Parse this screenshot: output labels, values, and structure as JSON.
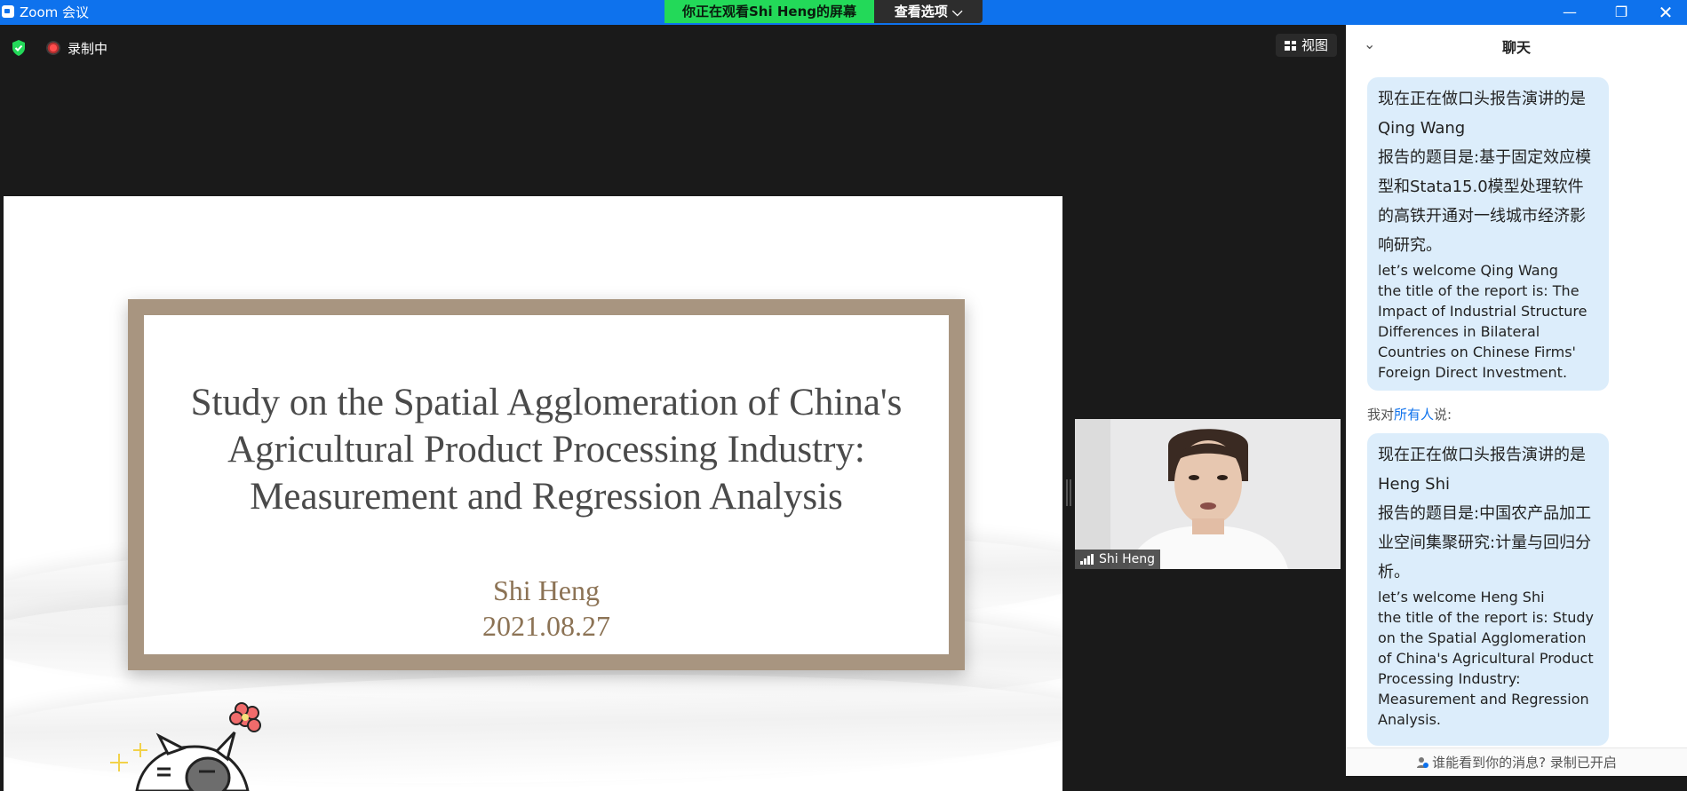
{
  "window": {
    "title": "Zoom 会议",
    "viewing_banner": "你正在观看Shi Heng的屏幕",
    "view_options_label": "查看选项",
    "minimize_icon": "—",
    "restore_icon": "❐",
    "close_icon": "✕"
  },
  "meeting": {
    "recording_label": "录制中",
    "view_label": "视图",
    "security_color": "#23d959"
  },
  "slide": {
    "title": "Study on the Spatial Agglomeration of China's\nAgricultural Product Processing Industry:\nMeasurement and Regression Analysis",
    "author": "Shi Heng",
    "date": "2021.08.27",
    "frame_color": "#a89580"
  },
  "video": {
    "participant_name": "Shi Heng"
  },
  "chat": {
    "title": "聊天",
    "messages": [
      {
        "zh_1": "现在正在做口头报告演讲的是Qing Wang",
        "zh_2": "报告的题目是:基于固定效应模型和Stata15.0模型处理软件的高铁开通对一线城市经济影响研究。",
        "en_1": "let’s welcome Qing Wang",
        "en_2": "the title of the report is: The Impact of Industrial Structure Differences in Bilateral Countries on Chinese Firms' Foreign Direct Investment."
      },
      {
        "zh_1": "现在正在做口头报告演讲的是Heng Shi",
        "zh_2": "报告的题目是:中国农产品加工业空间集聚研究:计量与回归分析。",
        "en_1": "let’s welcome Heng Shi",
        "en_2": "the title of the report is: Study on the Spatial Agglomeration of China's Agricultural Product Processing Industry: Measurement and Regression Analysis."
      }
    ],
    "to_prefix": "我对",
    "to_recipient": "所有人",
    "to_suffix": "说:",
    "footer": "谁能看到你的消息? 录制已开启",
    "bubble_color": "#dcedfb",
    "accent_color": "#0e72ed"
  }
}
